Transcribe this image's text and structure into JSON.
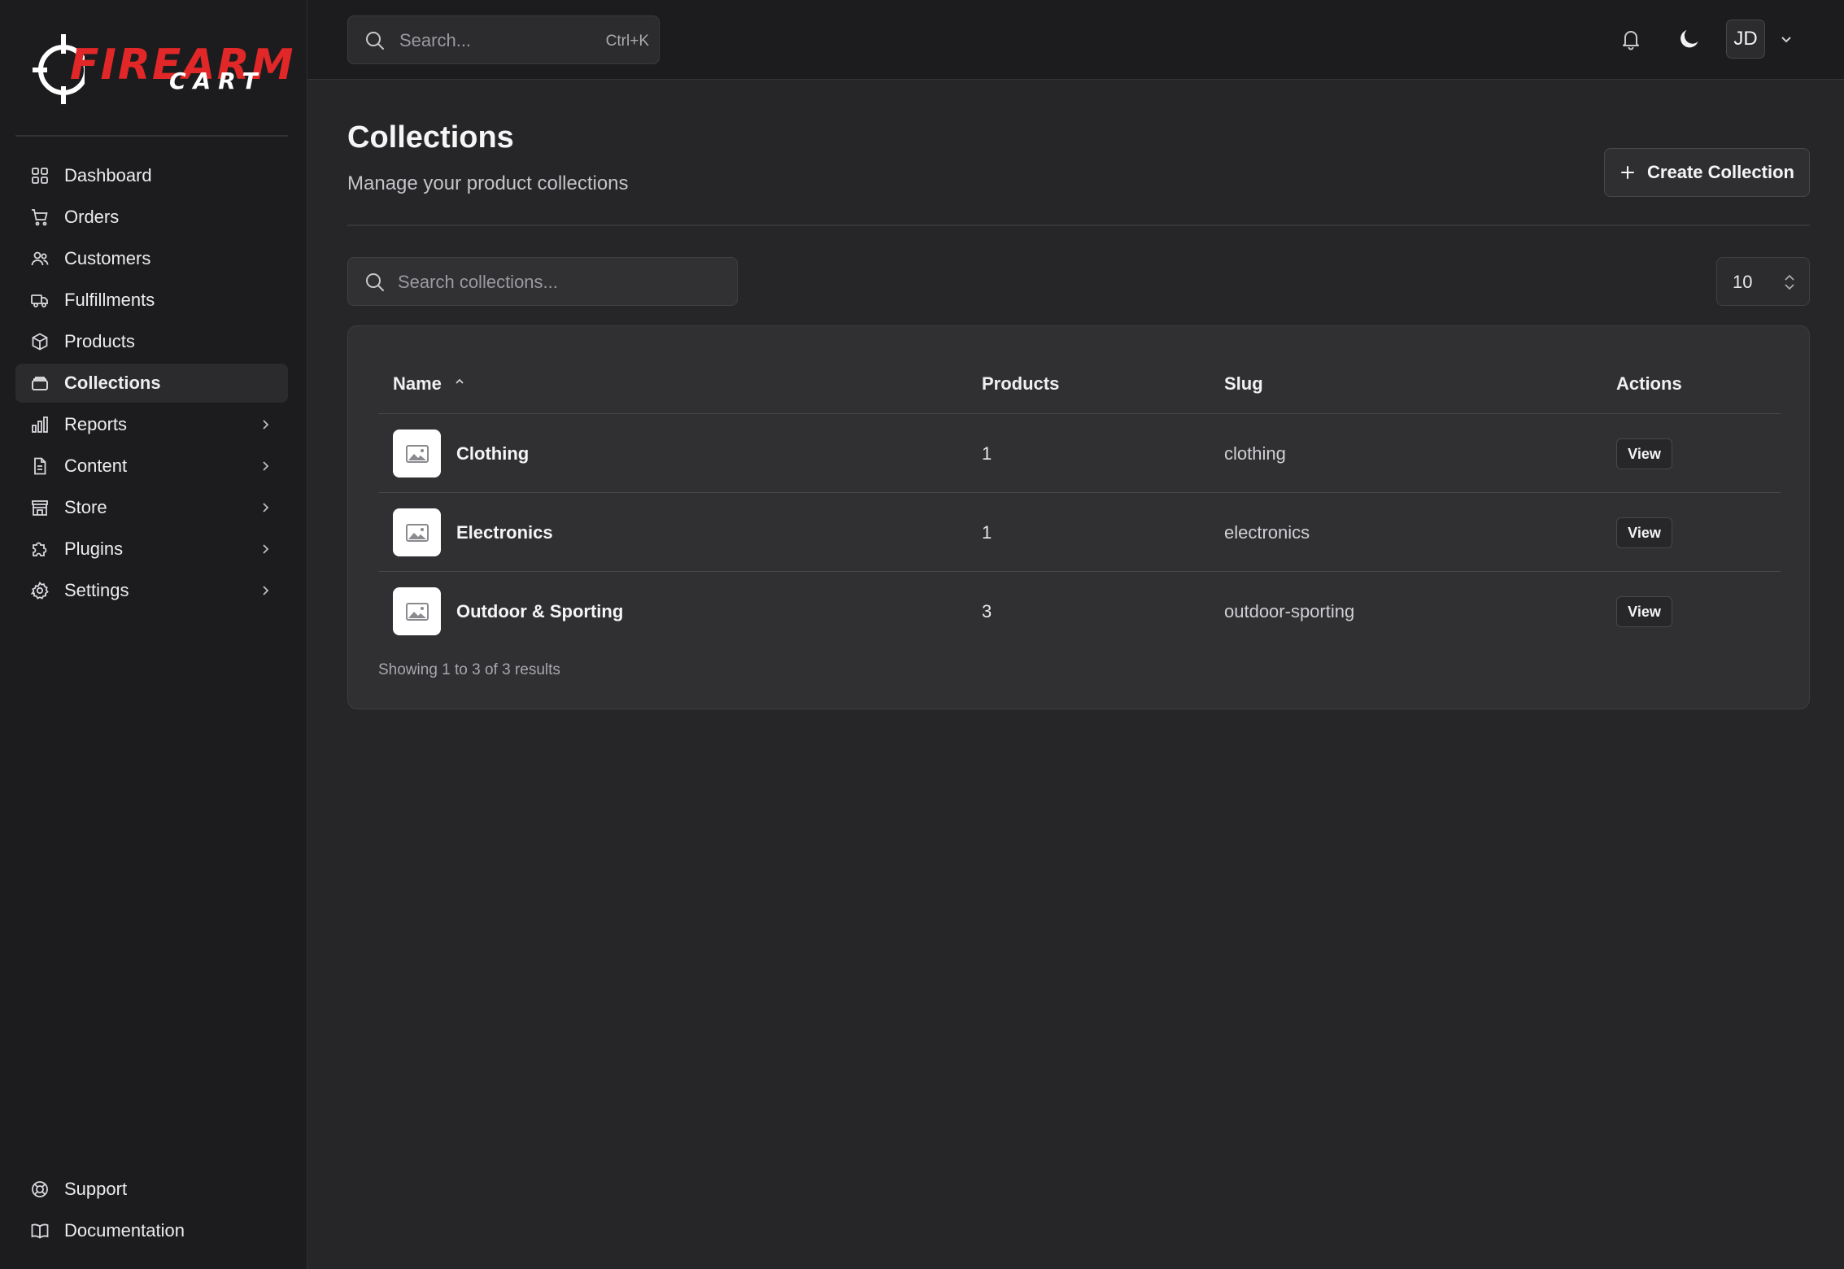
{
  "brand": {
    "name_top": "FIREARM",
    "name_bottom": "CART",
    "accent": "#e12727"
  },
  "sidebar": {
    "items": [
      {
        "label": "Dashboard",
        "icon": "grid-icon",
        "active": false,
        "has_submenu": false
      },
      {
        "label": "Orders",
        "icon": "cart-icon",
        "active": false,
        "has_submenu": false
      },
      {
        "label": "Customers",
        "icon": "users-icon",
        "active": false,
        "has_submenu": false
      },
      {
        "label": "Fulfillments",
        "icon": "truck-icon",
        "active": false,
        "has_submenu": false
      },
      {
        "label": "Products",
        "icon": "box-icon",
        "active": false,
        "has_submenu": false
      },
      {
        "label": "Collections",
        "icon": "layers-icon",
        "active": true,
        "has_submenu": false
      },
      {
        "label": "Reports",
        "icon": "bar-chart-icon",
        "active": false,
        "has_submenu": true
      },
      {
        "label": "Content",
        "icon": "file-icon",
        "active": false,
        "has_submenu": true
      },
      {
        "label": "Store",
        "icon": "store-icon",
        "active": false,
        "has_submenu": true
      },
      {
        "label": "Plugins",
        "icon": "puzzle-icon",
        "active": false,
        "has_submenu": true
      },
      {
        "label": "Settings",
        "icon": "gear-icon",
        "active": false,
        "has_submenu": true
      }
    ],
    "bottom": [
      {
        "label": "Support",
        "icon": "lifebuoy-icon"
      },
      {
        "label": "Documentation",
        "icon": "book-icon"
      }
    ]
  },
  "topbar": {
    "search_placeholder": "Search...",
    "search_shortcut": "Ctrl+K",
    "user_initials": "JD"
  },
  "page": {
    "title": "Collections",
    "subtitle": "Manage your product collections",
    "create_button": "Create Collection",
    "search_placeholder": "Search collections...",
    "per_page": "10"
  },
  "table": {
    "columns": {
      "name": "Name",
      "products": "Products",
      "slug": "Slug",
      "actions": "Actions"
    },
    "sort": {
      "column": "Name",
      "direction": "asc"
    },
    "rows": [
      {
        "name": "Clothing",
        "products": "1",
        "slug": "clothing",
        "action": "View"
      },
      {
        "name": "Electronics",
        "products": "1",
        "slug": "electronics",
        "action": "View"
      },
      {
        "name": "Outdoor & Sporting",
        "products": "3",
        "slug": "outdoor-sporting",
        "action": "View"
      }
    ],
    "summary": "Showing 1 to 3 of 3 results"
  }
}
